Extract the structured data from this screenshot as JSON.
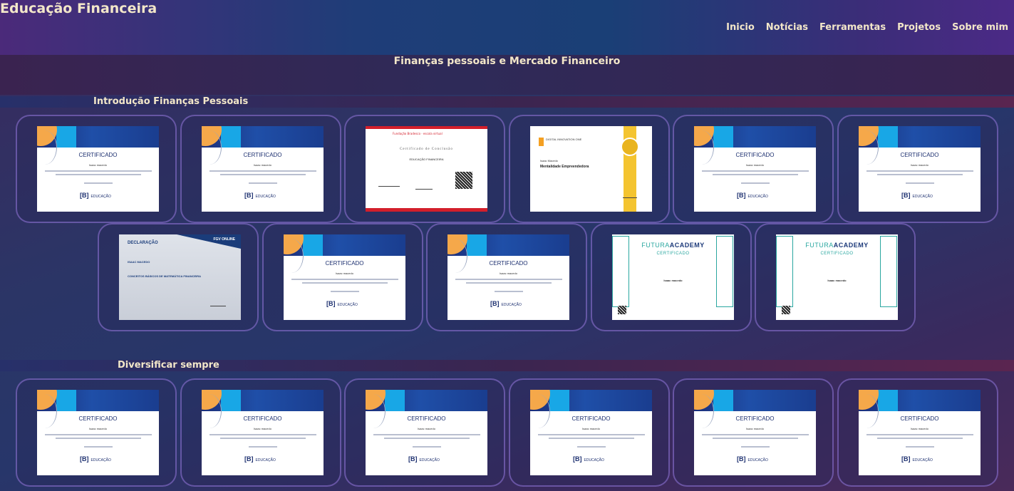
{
  "header": {
    "site_title": "Educação Financeira",
    "nav": [
      "Inicio",
      "Notícias",
      "Ferramentas",
      "Projetos",
      "Sobre mim"
    ]
  },
  "page_title": "Finanças pessoais e Mercado Financeiro",
  "sections": [
    {
      "title": "Introdução Finanças Pessoais",
      "rows": [
        [
          {
            "kind": "b3",
            "heading": "CERTIFICADO",
            "name": "Isaac macedo",
            "footer": "EDUCAÇÃO"
          },
          {
            "kind": "b3",
            "heading": "CERTIFICADO",
            "name": "Isaac macedo",
            "footer": "EDUCAÇÃO"
          },
          {
            "kind": "fundacao",
            "heading": "Certificado de Conclusão",
            "brand": "Fundação Bradesco · escola virtual",
            "course": "EDUCAÇÃO FINANCEIRA"
          },
          {
            "kind": "dio",
            "brand": "DIGITAL INNOVATION ONE",
            "name": "Isaac Macedo",
            "course": "Mentalidade Empreendedora"
          },
          {
            "kind": "b3",
            "heading": "CERTIFICADO",
            "name": "Isaac macedo",
            "footer": "EDUCAÇÃO"
          },
          {
            "kind": "b3",
            "heading": "CERTIFICADO",
            "name": "Isaac macedo",
            "footer": "EDUCAÇÃO"
          }
        ],
        [
          {
            "kind": "fgv",
            "heading": "DECLARAÇÃO",
            "brand": "FGV ONLINE",
            "name": "ISAAC MACEDO",
            "course": "CONCEITOS BÁSICOS DE MATEMÁTICA FINANCEIRA"
          },
          {
            "kind": "b3",
            "heading": "CERTIFICADO",
            "name": "Isaac macedo",
            "footer": "EDUCAÇÃO"
          },
          {
            "kind": "b3",
            "heading": "CERTIFICADO",
            "name": "Isaac macedo",
            "footer": "EDUCAÇÃO"
          },
          {
            "kind": "futura",
            "brand_a": "FUTURA",
            "brand_b": "ACADEMY",
            "heading": "CERTIFICADO",
            "name": "Isaac macedo"
          },
          {
            "kind": "futura",
            "brand_a": "FUTURA",
            "brand_b": "ACADEMY",
            "heading": "CERTIFICADO",
            "name": "Isaac macedo"
          }
        ]
      ]
    },
    {
      "title": "Diversificar sempre",
      "rows": [
        [
          {
            "kind": "b3",
            "heading": "CERTIFICADO",
            "name": "Isaac macedo",
            "footer": "EDUCAÇÃO"
          },
          {
            "kind": "b3",
            "heading": "CERTIFICADO",
            "name": "Isaac macedo",
            "footer": "EDUCAÇÃO"
          },
          {
            "kind": "b3",
            "heading": "CERTIFICADO",
            "name": "Isaac macedo",
            "footer": "EDUCAÇÃO"
          },
          {
            "kind": "b3",
            "heading": "CERTIFICADO",
            "name": "Isaac macedo",
            "footer": "EDUCAÇÃO"
          },
          {
            "kind": "b3",
            "heading": "CERTIFICADO",
            "name": "Isaac macedo",
            "footer": "EDUCAÇÃO"
          },
          {
            "kind": "b3",
            "heading": "CERTIFICADO",
            "name": "Isaac macedo",
            "footer": "EDUCAÇÃO"
          }
        ]
      ]
    }
  ]
}
